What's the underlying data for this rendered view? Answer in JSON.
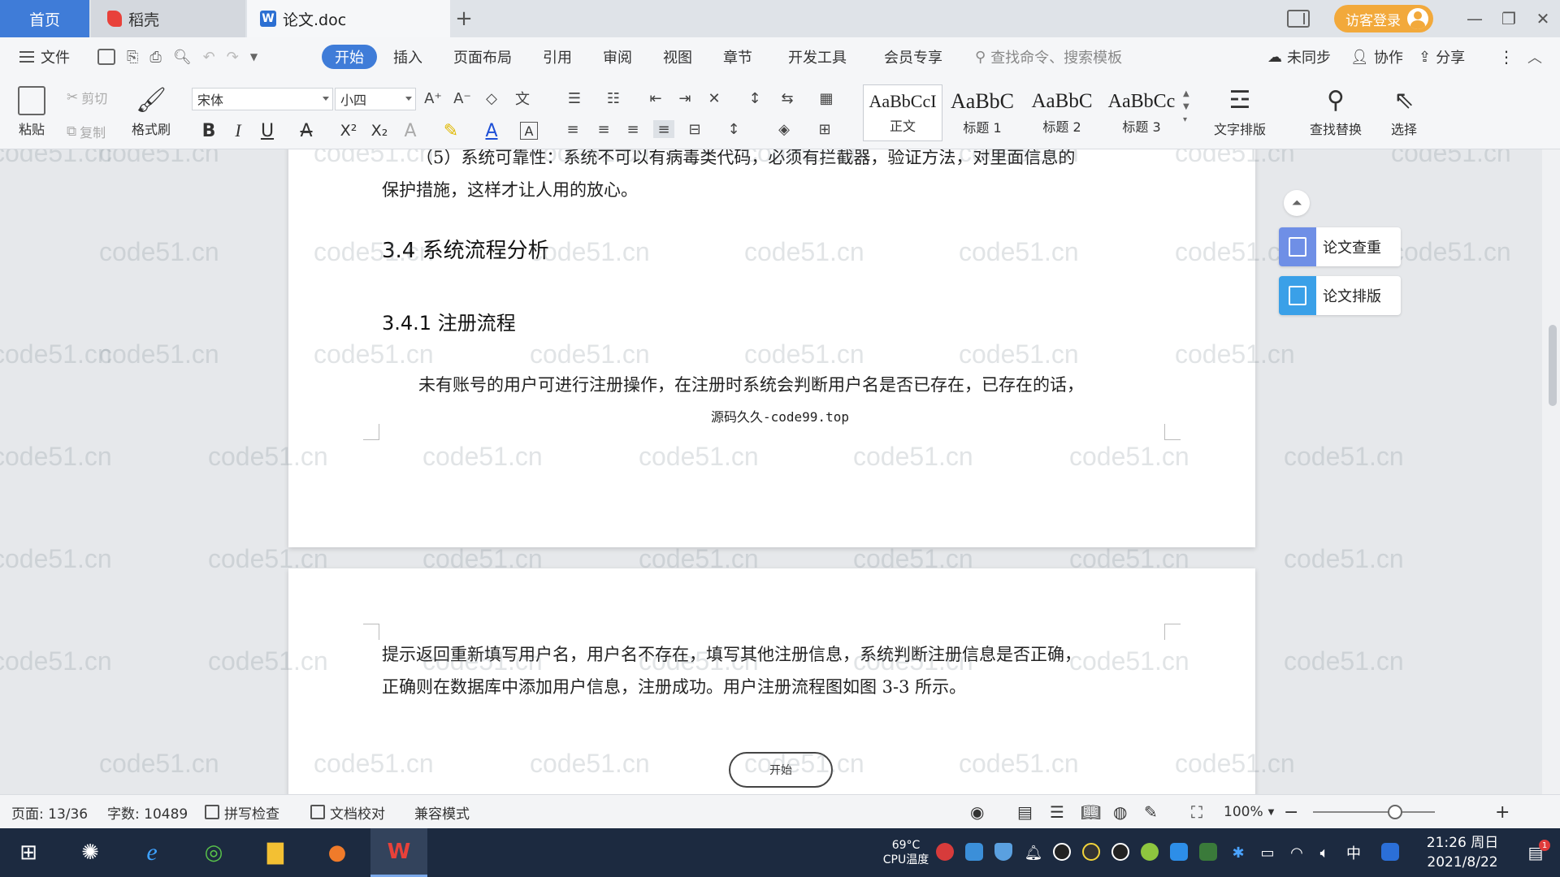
{
  "tabs": {
    "home": "首页",
    "daoke": "稻壳",
    "doc": "论文.doc",
    "add": "+"
  },
  "title_right": {
    "visitor_login": "访客登录"
  },
  "menu": {
    "file": "文件",
    "items": [
      "开始",
      "插入",
      "页面布局",
      "引用",
      "审阅",
      "视图",
      "章节",
      "开发工具",
      "会员专享"
    ],
    "search_placeholder": "查找命令、搜索模板",
    "unsynced": "未同步",
    "collaborate": "协作",
    "share": "分享"
  },
  "ribbon": {
    "paste": "粘贴",
    "cut": "剪切",
    "copy": "复制",
    "format_painter": "格式刷",
    "font_name": "宋体",
    "font_size": "小四",
    "styles": [
      {
        "preview": "AaBbCcI",
        "name": "正文"
      },
      {
        "preview": "AaBbC",
        "name": "标题 1"
      },
      {
        "preview": "AaBbC",
        "name": "标题 2"
      },
      {
        "preview": "AaBbCc",
        "name": "标题 3"
      }
    ],
    "text_layout": "文字排版",
    "find_replace": "查找替换",
    "select": "选择"
  },
  "document": {
    "p_reliability_1": "（5）系统可靠性：系统不可以有病毒类代码，必须有拦截器，验证方法，对里面信息的",
    "p_reliability_2": "保护措施，这样才让人用的放心。",
    "h_3_4": "3.4 系统流程分析",
    "h_3_4_1": "3.4.1 注册流程",
    "p_register_1": "未有账号的用户可进行注册操作，在注册时系统会判断用户名是否已存在，已存在的话，",
    "footer_source": "源码久久-code99.top",
    "p_register_2": "提示返回重新填写用户名，用户名不存在，填写其他注册信息，系统判断注册信息是否正确，",
    "p_register_3": "正确则在数据库中添加用户信息，注册成功。用户注册流程图如图 3-3 所示。",
    "flow_start": "开始",
    "watermark": "code51.cn"
  },
  "side_panel": {
    "check": "论文查重",
    "layout": "论文排版"
  },
  "statusbar": {
    "page": "页面: 13/36",
    "words": "字数: 10489",
    "spell": "拼写检查",
    "proof": "文档校对",
    "compat": "兼容模式",
    "zoom": "100%"
  },
  "taskbar": {
    "cpu_temp": "69°C",
    "cpu_label": "CPU温度",
    "ime": "中",
    "time": "21:26 周日",
    "date": "2021/8/22",
    "notif_count": "1"
  },
  "colors": {
    "accent": "#3f7cd8",
    "visitor": "#f2a93b",
    "taskbar": "#1c2a40",
    "side_check": "#6f8fe6",
    "side_layout": "#3aa0e8"
  }
}
